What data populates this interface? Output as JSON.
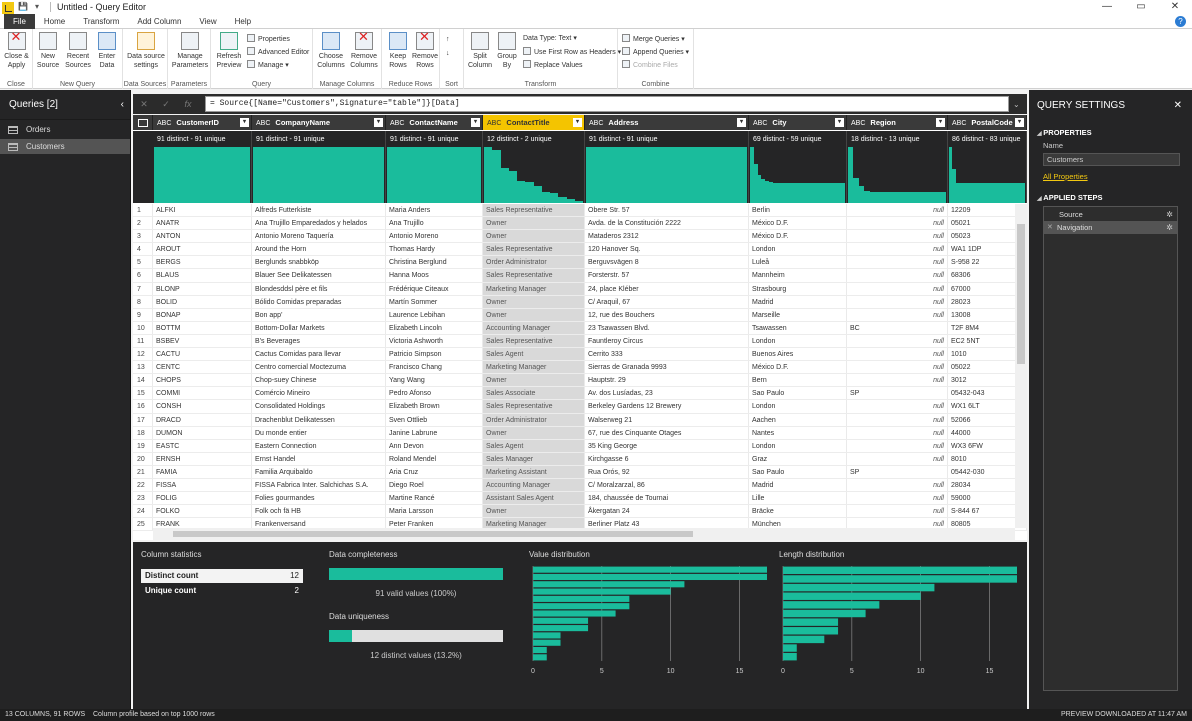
{
  "window": {
    "title": "Untitled - Query Editor",
    "controls": [
      "—",
      "▭",
      "✕"
    ]
  },
  "menu": {
    "tabs": [
      "File",
      "Home",
      "Transform",
      "Add Column",
      "View",
      "Help"
    ],
    "help_label": "?"
  },
  "ribbon": {
    "close_apply": "Close & Apply",
    "new_source": "New Source",
    "recent_sources": "Recent Sources",
    "enter_data": "Enter Data",
    "data_source_settings": "Data source settings",
    "manage_parameters": "Manage Parameters",
    "refresh_preview": "Refresh Preview",
    "properties": "Properties",
    "advanced_editor": "Advanced Editor",
    "manage": "Manage",
    "choose_columns": "Choose Columns",
    "remove_columns": "Remove Columns",
    "keep_rows": "Keep Rows",
    "remove_rows": "Remove Rows",
    "split_column": "Split Column",
    "group_by": "Group By",
    "data_type": "Data Type: Text",
    "first_row_headers": "Use First Row as Headers",
    "replace_values": "Replace Values",
    "merge_queries": "Merge Queries",
    "append_queries": "Append Queries",
    "combine_files": "Combine Files",
    "groups": {
      "close": "Close",
      "new_query": "New Query",
      "data_sources": "Data Sources",
      "parameters": "Parameters",
      "query": "Query",
      "manage_columns": "Manage Columns",
      "reduce_rows": "Reduce Rows",
      "sort": "Sort",
      "transform": "Transform",
      "combine": "Combine"
    }
  },
  "queries": {
    "header": "Queries [2]",
    "items": [
      "Orders",
      "Customers"
    ],
    "selected": "Customers"
  },
  "formula": "= Source{[Name=\"Customers\",Signature=\"table\"]}[Data]",
  "columns": [
    {
      "name": "CustomerID",
      "type": "ABC",
      "profile": "91 distinct - 91 unique"
    },
    {
      "name": "CompanyName",
      "type": "ABC",
      "profile": "91 distinct - 91 unique"
    },
    {
      "name": "ContactName",
      "type": "ABC",
      "profile": "91 distinct - 91 unique"
    },
    {
      "name": "ContactTitle",
      "type": "ABC",
      "profile": "12 distinct - 2 unique"
    },
    {
      "name": "Address",
      "type": "ABC",
      "profile": "91 distinct - 91 unique"
    },
    {
      "name": "City",
      "type": "ABC",
      "profile": "69 distinct - 59 unique"
    },
    {
      "name": "Region",
      "type": "ABC",
      "profile": "18 distinct - 13 unique"
    },
    {
      "name": "PostalCode",
      "type": "ABC",
      "profile": "86 distinct - 83 unique"
    }
  ],
  "selected_column": "ContactTitle",
  "rows": [
    [
      "1",
      "ALFKI",
      "Alfreds Futterkiste",
      "Maria Anders",
      "Sales Representative",
      "Obere Str. 57",
      "Berlin",
      "null",
      "12209"
    ],
    [
      "2",
      "ANATR",
      "Ana Trujillo Emparedados y helados",
      "Ana Trujillo",
      "Owner",
      "Avda. de la Constitución 2222",
      "México D.F.",
      "null",
      "05021"
    ],
    [
      "3",
      "ANTON",
      "Antonio Moreno Taquería",
      "Antonio Moreno",
      "Owner",
      "Mataderos  2312",
      "México D.F.",
      "null",
      "05023"
    ],
    [
      "4",
      "AROUT",
      "Around the Horn",
      "Thomas Hardy",
      "Sales Representative",
      "120 Hanover Sq.",
      "London",
      "null",
      "WA1 1DP"
    ],
    [
      "5",
      "BERGS",
      "Berglunds snabbköp",
      "Christina Berglund",
      "Order Administrator",
      "Berguvsvägen  8",
      "Luleå",
      "null",
      "S-958 22"
    ],
    [
      "6",
      "BLAUS",
      "Blauer See Delikatessen",
      "Hanna Moos",
      "Sales Representative",
      "Forsterstr. 57",
      "Mannheim",
      "null",
      "68306"
    ],
    [
      "7",
      "BLONP",
      "Blondesddsl père et fils",
      "Frédérique Citeaux",
      "Marketing Manager",
      "24, place Kléber",
      "Strasbourg",
      "null",
      "67000"
    ],
    [
      "8",
      "BOLID",
      "Bólido Comidas preparadas",
      "Martín Sommer",
      "Owner",
      "C/ Araquil, 67",
      "Madrid",
      "null",
      "28023"
    ],
    [
      "9",
      "BONAP",
      "Bon app'",
      "Laurence Lebihan",
      "Owner",
      "12, rue des Bouchers",
      "Marseille",
      "null",
      "13008"
    ],
    [
      "10",
      "BOTTM",
      "Bottom-Dollar Markets",
      "Elizabeth Lincoln",
      "Accounting Manager",
      "23 Tsawassen Blvd.",
      "Tsawassen",
      "BC",
      "T2F 8M4"
    ],
    [
      "11",
      "BSBEV",
      "B's Beverages",
      "Victoria Ashworth",
      "Sales Representative",
      "Fauntleroy Circus",
      "London",
      "null",
      "EC2 5NT"
    ],
    [
      "12",
      "CACTU",
      "Cactus Comidas para llevar",
      "Patricio Simpson",
      "Sales Agent",
      "Cerrito 333",
      "Buenos Aires",
      "null",
      "1010"
    ],
    [
      "13",
      "CENTC",
      "Centro comercial Moctezuma",
      "Francisco Chang",
      "Marketing Manager",
      "Sierras de Granada 9993",
      "México D.F.",
      "null",
      "05022"
    ],
    [
      "14",
      "CHOPS",
      "Chop-suey Chinese",
      "Yang Wang",
      "Owner",
      "Hauptstr. 29",
      "Bern",
      "null",
      "3012"
    ],
    [
      "15",
      "COMMI",
      "Comércio Mineiro",
      "Pedro Afonso",
      "Sales Associate",
      "Av. dos Lusíadas, 23",
      "Sao Paulo",
      "SP",
      "05432-043"
    ],
    [
      "16",
      "CONSH",
      "Consolidated Holdings",
      "Elizabeth Brown",
      "Sales Representative",
      "Berkeley Gardens 12  Brewery",
      "London",
      "null",
      "WX1 6LT"
    ],
    [
      "17",
      "DRACD",
      "Drachenblut Delikatessen",
      "Sven Ottlieb",
      "Order Administrator",
      "Walserweg 21",
      "Aachen",
      "null",
      "52066"
    ],
    [
      "18",
      "DUMON",
      "Du monde entier",
      "Janine Labrune",
      "Owner",
      "67, rue des Cinquante Otages",
      "Nantes",
      "null",
      "44000"
    ],
    [
      "19",
      "EASTC",
      "Eastern Connection",
      "Ann Devon",
      "Sales Agent",
      "35 King George",
      "London",
      "null",
      "WX3 6FW"
    ],
    [
      "20",
      "ERNSH",
      "Ernst Handel",
      "Roland Mendel",
      "Sales Manager",
      "Kirchgasse 6",
      "Graz",
      "null",
      "8010"
    ],
    [
      "21",
      "FAMIA",
      "Familia Arquibaldo",
      "Aria Cruz",
      "Marketing Assistant",
      "Rua Orós, 92",
      "Sao Paulo",
      "SP",
      "05442-030"
    ],
    [
      "22",
      "FISSA",
      "FISSA Fabrica Inter. Salchichas S.A.",
      "Diego Roel",
      "Accounting Manager",
      "C/ Moralzarzal, 86",
      "Madrid",
      "null",
      "28034"
    ],
    [
      "23",
      "FOLIG",
      "Folies gourmandes",
      "Martine Rancé",
      "Assistant Sales Agent",
      "184, chaussée de Tournai",
      "Lille",
      "null",
      "59000"
    ],
    [
      "24",
      "FOLKO",
      "Folk och fä HB",
      "Maria Larsson",
      "Owner",
      "Åkergatan 24",
      "Bräcke",
      "null",
      "S-844 67"
    ],
    [
      "25",
      "FRANK",
      "Frankenversand",
      "Peter Franken",
      "Marketing Manager",
      "Berliner Platz 43",
      "München",
      "null",
      "80805"
    ]
  ],
  "profile_pane": {
    "column_statistics": "Column statistics",
    "distinct_label": "Distinct count",
    "distinct_value": "12",
    "unique_label": "Unique count",
    "unique_value": "2",
    "completeness_title": "Data completeness",
    "completeness_text": "91 valid values (100%)",
    "completeness_fraction": 1.0,
    "uniqueness_title": "Data uniqueness",
    "uniqueness_text": "12 distinct values (13.2%)",
    "uniqueness_fraction": 0.132,
    "value_dist_title": "Value distribution",
    "length_dist_title": "Length distribution"
  },
  "chart_data": [
    {
      "type": "bar",
      "orientation": "horizontal",
      "title": "Value distribution",
      "xlim": [
        0,
        17
      ],
      "xticks": [
        0,
        5,
        10,
        15
      ],
      "values": [
        17,
        17,
        11,
        10,
        7,
        7,
        6,
        4,
        4,
        2,
        2,
        1,
        1
      ],
      "color": "#1abc9c"
    },
    {
      "type": "bar",
      "orientation": "horizontal",
      "title": "Length distribution",
      "xlim": [
        0,
        17
      ],
      "xticks": [
        0,
        5,
        10,
        15
      ],
      "values": [
        17,
        17,
        11,
        10,
        7,
        6,
        4,
        4,
        3,
        1,
        1
      ],
      "color": "#1abc9c"
    }
  ],
  "column_histograms": {
    "CustomerID": [
      1,
      1,
      1,
      1,
      1,
      1,
      1,
      1,
      1,
      1,
      1,
      1,
      1,
      1,
      1,
      1,
      1,
      1,
      1,
      1,
      1,
      1,
      1,
      1,
      1,
      1,
      1,
      1,
      1,
      1
    ],
    "CompanyName": [
      1,
      1,
      1,
      1,
      1,
      1,
      1,
      1,
      1,
      1,
      1,
      1,
      1,
      1,
      1,
      1,
      1,
      1,
      1,
      1,
      1,
      1,
      1,
      1,
      1,
      1,
      1,
      1,
      1,
      1,
      1,
      1,
      1,
      1,
      1,
      1,
      1,
      1,
      1,
      1
    ],
    "ContactName": [
      1,
      1,
      1,
      1,
      1,
      1,
      1,
      1,
      1,
      1,
      1,
      1,
      1,
      1,
      1,
      1,
      1,
      1,
      1,
      1,
      1,
      1,
      1,
      1,
      1,
      1,
      1,
      1,
      1,
      1
    ],
    "ContactTitle": [
      1,
      0.95,
      0.62,
      0.58,
      0.4,
      0.38,
      0.3,
      0.2,
      0.18,
      0.1,
      0.08,
      0.04
    ],
    "Address": [
      1,
      1,
      1,
      1,
      1,
      1,
      1,
      1,
      1,
      1,
      1,
      1,
      1,
      1,
      1,
      1,
      1,
      1,
      1,
      1,
      1,
      1,
      1,
      1,
      1,
      1,
      1,
      1,
      1,
      1,
      1,
      1,
      1,
      1,
      1,
      1,
      1,
      1,
      1,
      1,
      1,
      1,
      1,
      1,
      1,
      1,
      1,
      1,
      1,
      1,
      1,
      1,
      1,
      1,
      1
    ],
    "City": [
      1,
      0.7,
      0.5,
      0.42,
      0.4,
      0.38,
      0.36,
      0.36,
      0.36,
      0.36,
      0.36,
      0.36,
      0.36,
      0.36,
      0.36,
      0.36,
      0.36,
      0.36,
      0.36,
      0.36,
      0.36,
      0.36,
      0.36,
      0.36,
      0.36
    ],
    "Region": [
      1,
      0.45,
      0.3,
      0.22,
      0.2,
      0.2,
      0.2,
      0.2,
      0.2,
      0.2,
      0.2,
      0.2,
      0.2,
      0.2,
      0.2,
      0.2,
      0.2,
      0.2
    ],
    "PostalCode": [
      1,
      0.6,
      0.35,
      0.35,
      0.35,
      0.35,
      0.35,
      0.35,
      0.35,
      0.35,
      0.35,
      0.35,
      0.35,
      0.35,
      0.35,
      0.35,
      0.35,
      0.35,
      0.35,
      0.35,
      0.35,
      0.35
    ]
  },
  "query_settings": {
    "header": "QUERY SETTINGS",
    "properties": "PROPERTIES",
    "name_label": "Name",
    "name_value": "Customers",
    "all_properties": "All Properties",
    "applied_steps": "APPLIED STEPS",
    "steps": [
      "Source",
      "Navigation"
    ],
    "selected_step": "Navigation"
  },
  "status": {
    "left": "13 COLUMNS, 91 ROWS",
    "middle": "Column profile based on top 1000 rows",
    "right": "PREVIEW DOWNLOADED AT 11:47 AM"
  }
}
